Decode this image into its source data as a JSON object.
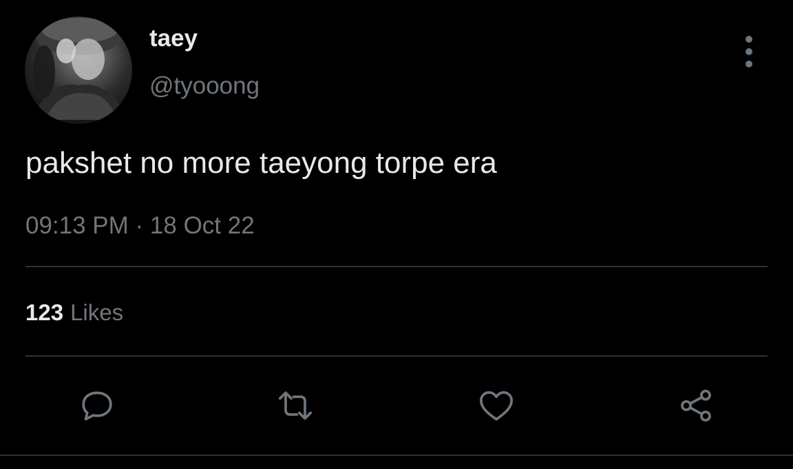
{
  "tweet": {
    "display_name": "taey",
    "handle": "@tyooong",
    "text": "pakshet no more taeyong torpe era",
    "timestamp": "09:13 PM · 18 Oct 22",
    "likes_count": "123",
    "likes_label": "Likes"
  },
  "icons": {
    "more": "more-vertical-icon",
    "reply": "reply-icon",
    "retweet": "retweet-icon",
    "like": "heart-icon",
    "share": "share-icon"
  },
  "colors": {
    "background": "#000000",
    "text_primary": "#e7e9ea",
    "text_secondary": "#71767b",
    "divider": "#2f3336",
    "icon": "#6e767d"
  }
}
